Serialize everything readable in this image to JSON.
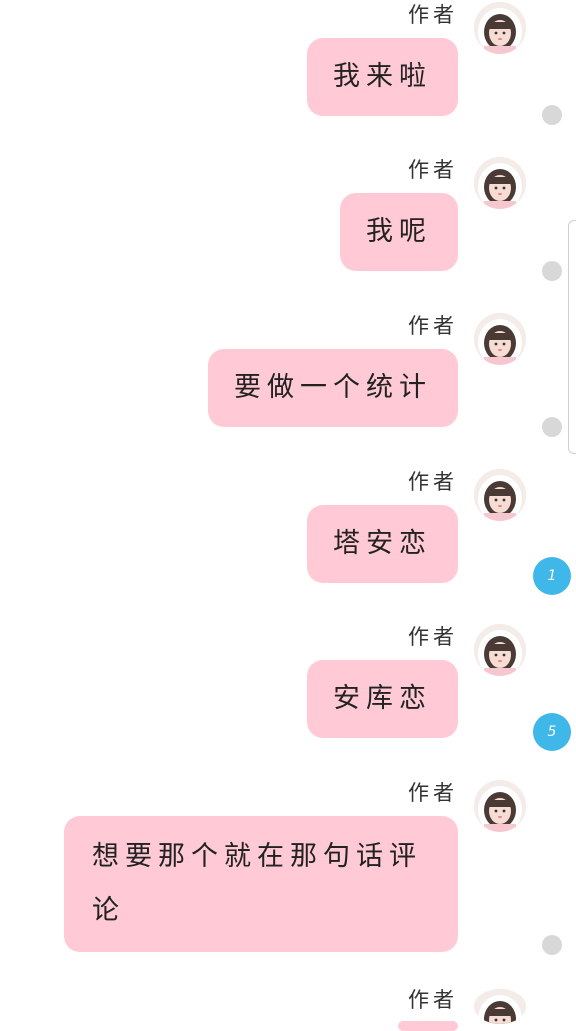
{
  "sender_name": "作者",
  "messages": [
    {
      "text": "我来啦",
      "badge": ""
    },
    {
      "text": "我呢",
      "badge": ""
    },
    {
      "text": "要做一个统计",
      "badge": ""
    },
    {
      "text": "塔安恋",
      "badge": "1"
    },
    {
      "text": "安库恋",
      "badge": "5"
    },
    {
      "text": "想要那个就在那句话评论",
      "badge": ""
    },
    {
      "text": "",
      "badge": ""
    }
  ],
  "colors": {
    "bubble": "#ffcad5",
    "badge_active": "#3fb7e8",
    "badge_idle": "#d8d8d8"
  },
  "icons": {
    "avatar": "girl-avatar-icon"
  }
}
